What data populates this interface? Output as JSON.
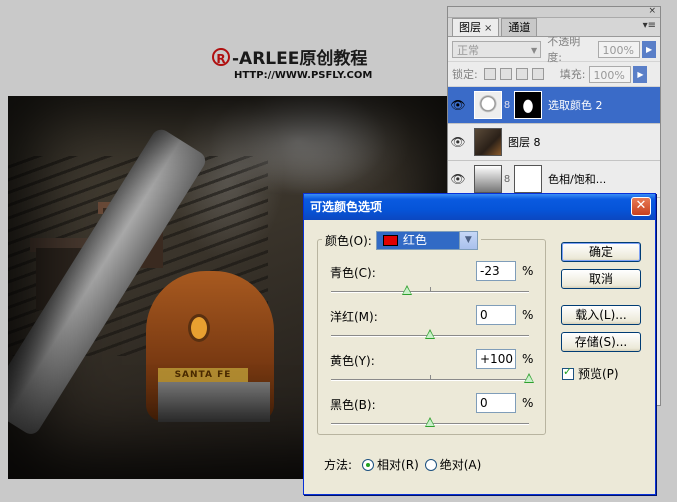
{
  "watermark": {
    "logo_letter": "R",
    "title": "-ARLEE原创教程",
    "url": "HTTP://WWW.PSFLY.COM"
  },
  "photo": {
    "plate_text": "SANTA FE"
  },
  "layers_panel": {
    "tabs": [
      {
        "label": "图层",
        "close": "×"
      },
      {
        "label": "通道"
      }
    ],
    "close_glyph": "×",
    "menu_glyph": "▾≡",
    "blend_mode": "正常",
    "opacity_label": "不透明度:",
    "opacity_value": "100%",
    "lock_label": "锁定:",
    "fill_label": "填充:",
    "fill_value": "100%",
    "layers": [
      {
        "name": "选取颜色 2",
        "selected": true
      },
      {
        "name": "图层 8",
        "selected": false
      },
      {
        "name": "色相/饱和...",
        "selected": false
      }
    ]
  },
  "dialog": {
    "title": "可选颜色选项",
    "colors_label": "颜色(O):",
    "colors_value": "红色",
    "colors_swatch": "#e00000",
    "sliders": [
      {
        "label": "青色(C):",
        "value": "-23",
        "fraction": 0.385
      },
      {
        "label": "洋红(M):",
        "value": "0",
        "fraction": 0.5
      },
      {
        "label": "黄色(Y):",
        "value": "+100",
        "fraction": 1.0
      },
      {
        "label": "黑色(B):",
        "value": "0",
        "fraction": 0.5
      }
    ],
    "percent": "%",
    "buttons": {
      "ok": "确定",
      "cancel": "取消",
      "load": "载入(L)...",
      "save": "存储(S)..."
    },
    "preview_label": "预览(P)",
    "method_label": "方法:",
    "method_relative": "相对(R)",
    "method_absolute": "绝对(A)"
  }
}
